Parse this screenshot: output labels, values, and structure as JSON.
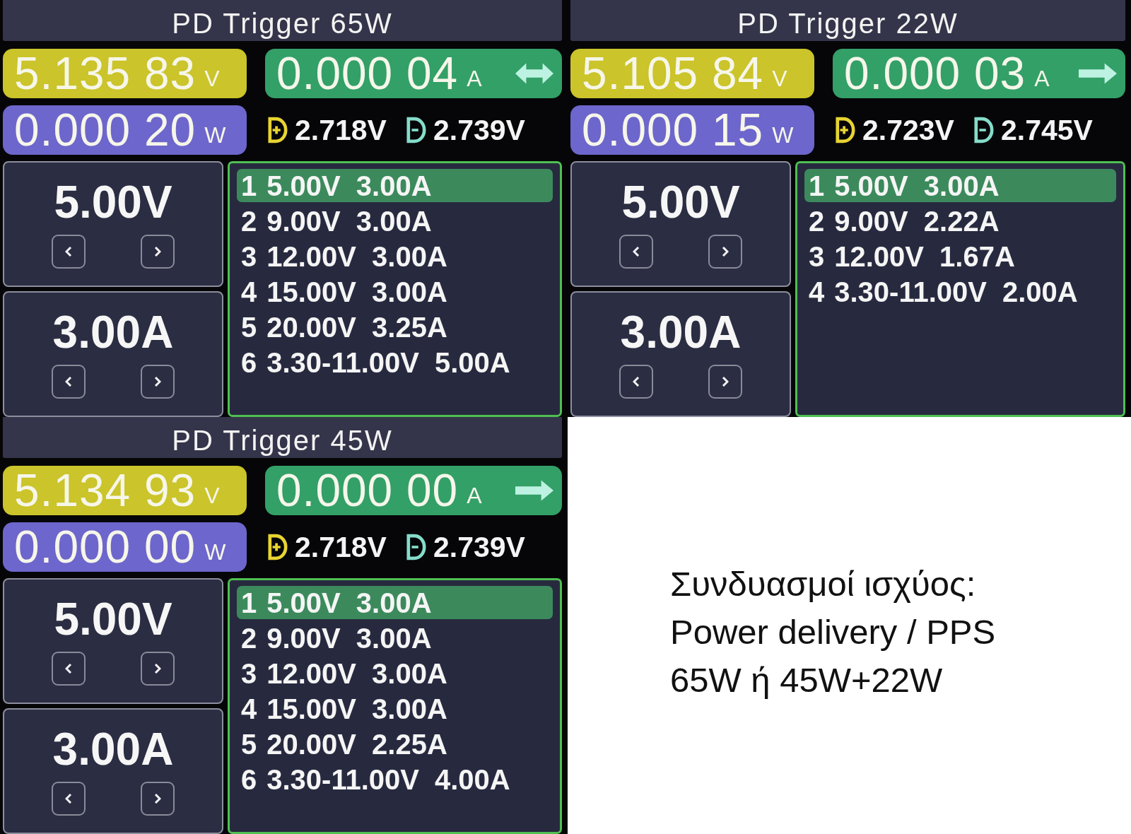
{
  "panels": [
    {
      "title": "PD Trigger 65W",
      "voltage": {
        "value": "5.135 83",
        "unit": "V"
      },
      "current": {
        "value": "0.000 04",
        "unit": "A",
        "kind": "bidirectional"
      },
      "power": {
        "value": "0.000 20",
        "unit": "W"
      },
      "d_plus": "2.718V",
      "d_minus": "2.739V",
      "set_voltage": "5.00V",
      "set_current": "3.00A",
      "profiles": [
        {
          "number": "1",
          "voltage": "5.00V",
          "current": "3.00A",
          "selected": true
        },
        {
          "number": "2",
          "voltage": "9.00V",
          "current": "3.00A",
          "selected": false
        },
        {
          "number": "3",
          "voltage": "12.00V",
          "current": "3.00A",
          "selected": false
        },
        {
          "number": "4",
          "voltage": "15.00V",
          "current": "3.00A",
          "selected": false
        },
        {
          "number": "5",
          "voltage": "20.00V",
          "current": "3.25A",
          "selected": false
        },
        {
          "number": "6",
          "voltage": "3.30-11.00V",
          "current": "5.00A",
          "selected": false
        }
      ]
    },
    {
      "title": "PD Trigger 22W",
      "voltage": {
        "value": "5.105 84",
        "unit": "V"
      },
      "current": {
        "value": "0.000 03",
        "unit": "A",
        "kind": "forward"
      },
      "power": {
        "value": "0.000 15",
        "unit": "W"
      },
      "d_plus": "2.723V",
      "d_minus": "2.745V",
      "set_voltage": "5.00V",
      "set_current": "3.00A",
      "profiles": [
        {
          "number": "1",
          "voltage": "5.00V",
          "current": "3.00A",
          "selected": true
        },
        {
          "number": "2",
          "voltage": "9.00V",
          "current": "2.22A",
          "selected": false
        },
        {
          "number": "3",
          "voltage": "12.00V",
          "current": "1.67A",
          "selected": false
        },
        {
          "number": "4",
          "voltage": "3.30-11.00V",
          "current": "2.00A",
          "selected": false
        }
      ]
    },
    {
      "title": "PD Trigger 45W",
      "voltage": {
        "value": "5.134 93",
        "unit": "V"
      },
      "current": {
        "value": "0.000 00",
        "unit": "A",
        "kind": "forward"
      },
      "power": {
        "value": "0.000 00",
        "unit": "W"
      },
      "d_plus": "2.718V",
      "d_minus": "2.739V",
      "set_voltage": "5.00V",
      "set_current": "3.00A",
      "profiles": [
        {
          "number": "1",
          "voltage": "5.00V",
          "current": "3.00A",
          "selected": true
        },
        {
          "number": "2",
          "voltage": "9.00V",
          "current": "3.00A",
          "selected": false
        },
        {
          "number": "3",
          "voltage": "12.00V",
          "current": "3.00A",
          "selected": false
        },
        {
          "number": "4",
          "voltage": "15.00V",
          "current": "3.00A",
          "selected": false
        },
        {
          "number": "5",
          "voltage": "20.00V",
          "current": "2.25A",
          "selected": false
        },
        {
          "number": "6",
          "voltage": "3.30-11.00V",
          "current": "4.00A",
          "selected": false
        }
      ]
    }
  ],
  "caption": {
    "lines": [
      "Συνδυασμοί ισχύος:",
      "Power delivery / PPS",
      "65W ή 45W+22W"
    ]
  }
}
